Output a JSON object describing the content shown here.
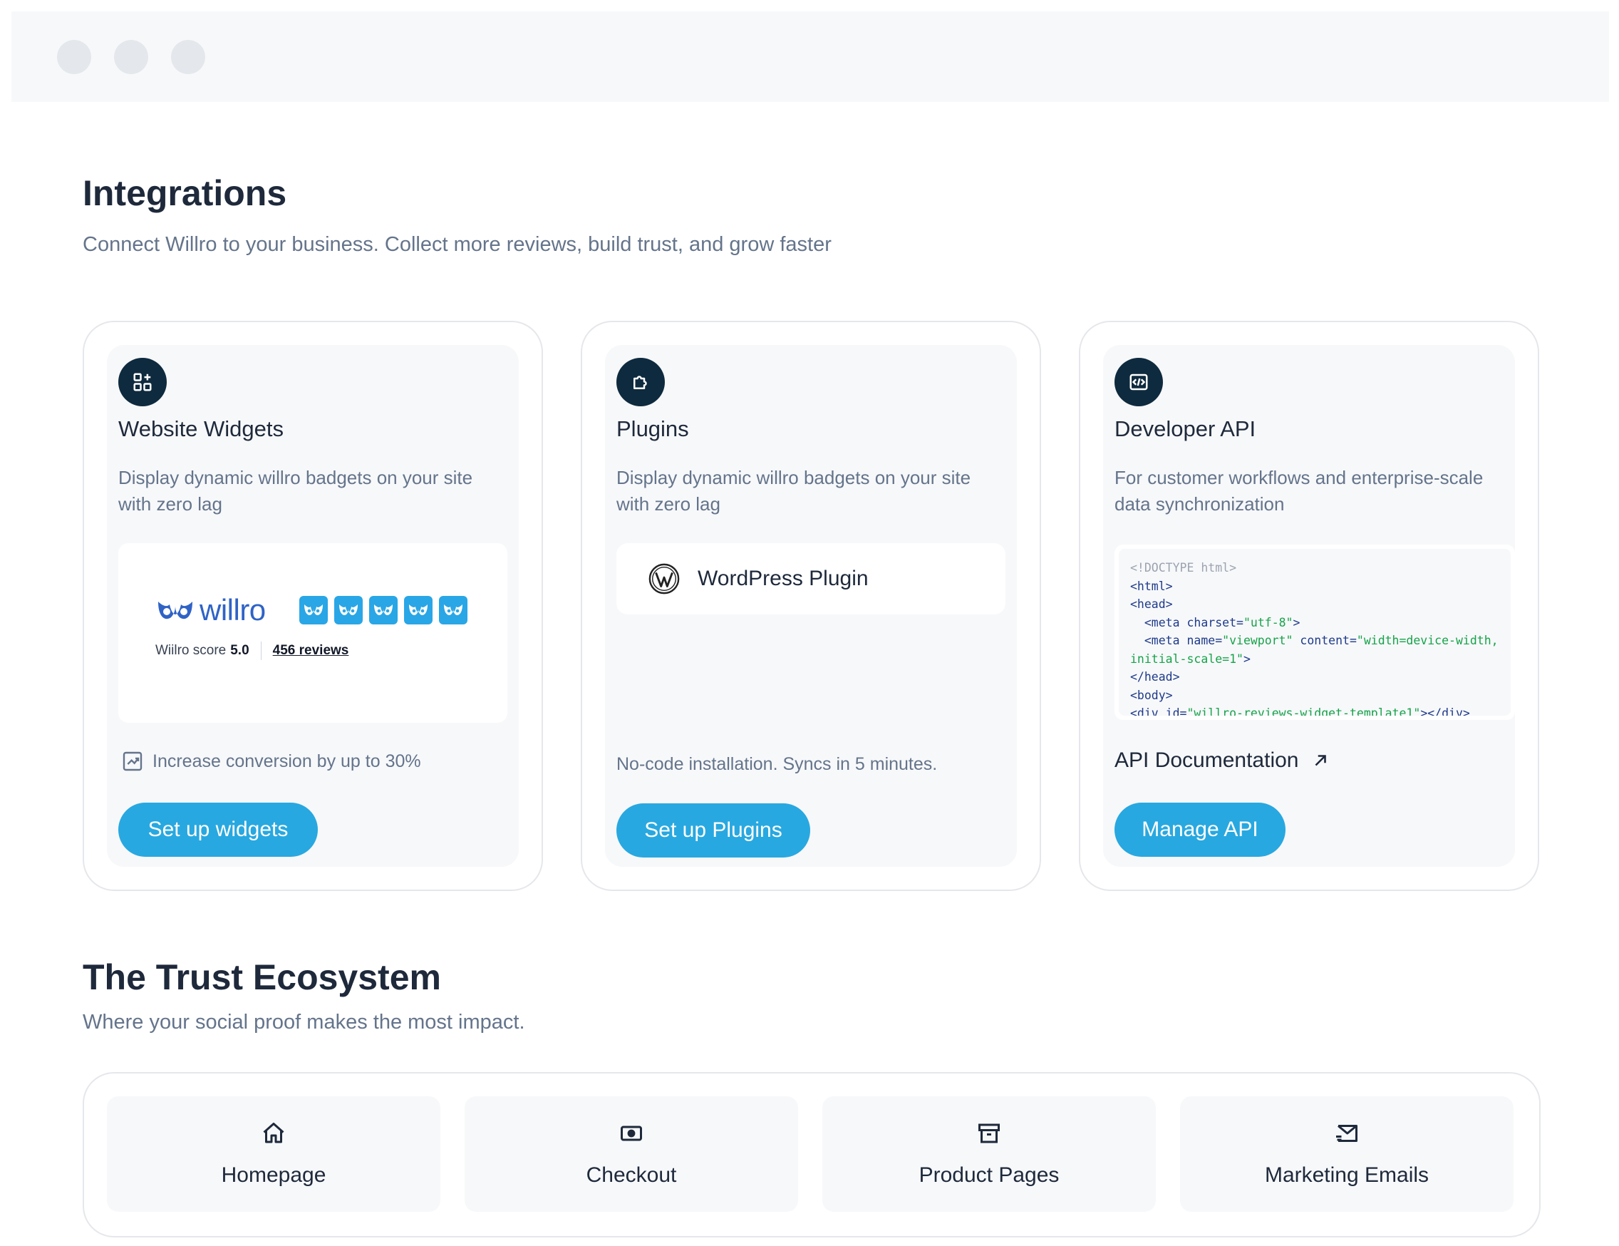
{
  "window": {
    "controls": [
      "window-dot",
      "window-dot",
      "window-dot"
    ]
  },
  "header": {
    "title": "Integrations",
    "subtitle": "Connect Willro to your business. Collect more reviews, build trust, and grow faster"
  },
  "cards": {
    "widgets": {
      "icon": "widgets-icon",
      "title": "Website Widgets",
      "description": "Display dynamic willro badgets on your site with zero lag",
      "badge": {
        "logo_text": "willro",
        "score_label": "Wiilro score",
        "score_value": "5.0",
        "reviews": "456 reviews",
        "stars_filled": 5,
        "stars_total": 5
      },
      "benefit": "Increase conversion by up to 30%",
      "button": "Set up widgets"
    },
    "plugins": {
      "icon": "puzzle-icon",
      "title": "Plugins",
      "description": "Display dynamic willro badgets on your site with zero lag",
      "plugin_name": "WordPress Plugin",
      "note": "No-code installation. Syncs in 5 minutes.",
      "button": "Set up Plugins"
    },
    "api": {
      "icon": "code-icon",
      "title": "Developer API",
      "description": "For customer workflows and enterprise-scale data synchronization",
      "code": {
        "l1": "<!DOCTYPE html>",
        "l2": "<html>",
        "l3": "<head>",
        "l4a": "  <meta charset=",
        "l4b": "\"utf-8\"",
        "l4c": ">",
        "l5a": "  <meta name=",
        "l5b": "\"viewport\"",
        "l5c": " content=",
        "l5d": "\"width=device-width, initial-scale=1\"",
        "l5e": ">",
        "l6": "</head>",
        "l7": "<body>",
        "l8a": "<div id=",
        "l8b": "\"willro-reviews-widget-template1\"",
        "l8c": "></div>"
      },
      "docs_link": "API Documentation",
      "button": "Manage API"
    }
  },
  "ecosystem": {
    "title": "The Trust Ecosystem",
    "subtitle": "Where your social proof makes the most impact.",
    "items": [
      {
        "label": "Homepage",
        "icon": "home-icon"
      },
      {
        "label": "Checkout",
        "icon": "cash-icon"
      },
      {
        "label": "Product Pages",
        "icon": "archive-box-icon"
      },
      {
        "label": "Marketing Emails",
        "icon": "mail-send-icon"
      }
    ]
  },
  "colors": {
    "accent": "#28a8e0",
    "icon_bg": "#0e2a3e",
    "brand_blue": "#2f63c6",
    "star_blue": "#29a6e6"
  }
}
